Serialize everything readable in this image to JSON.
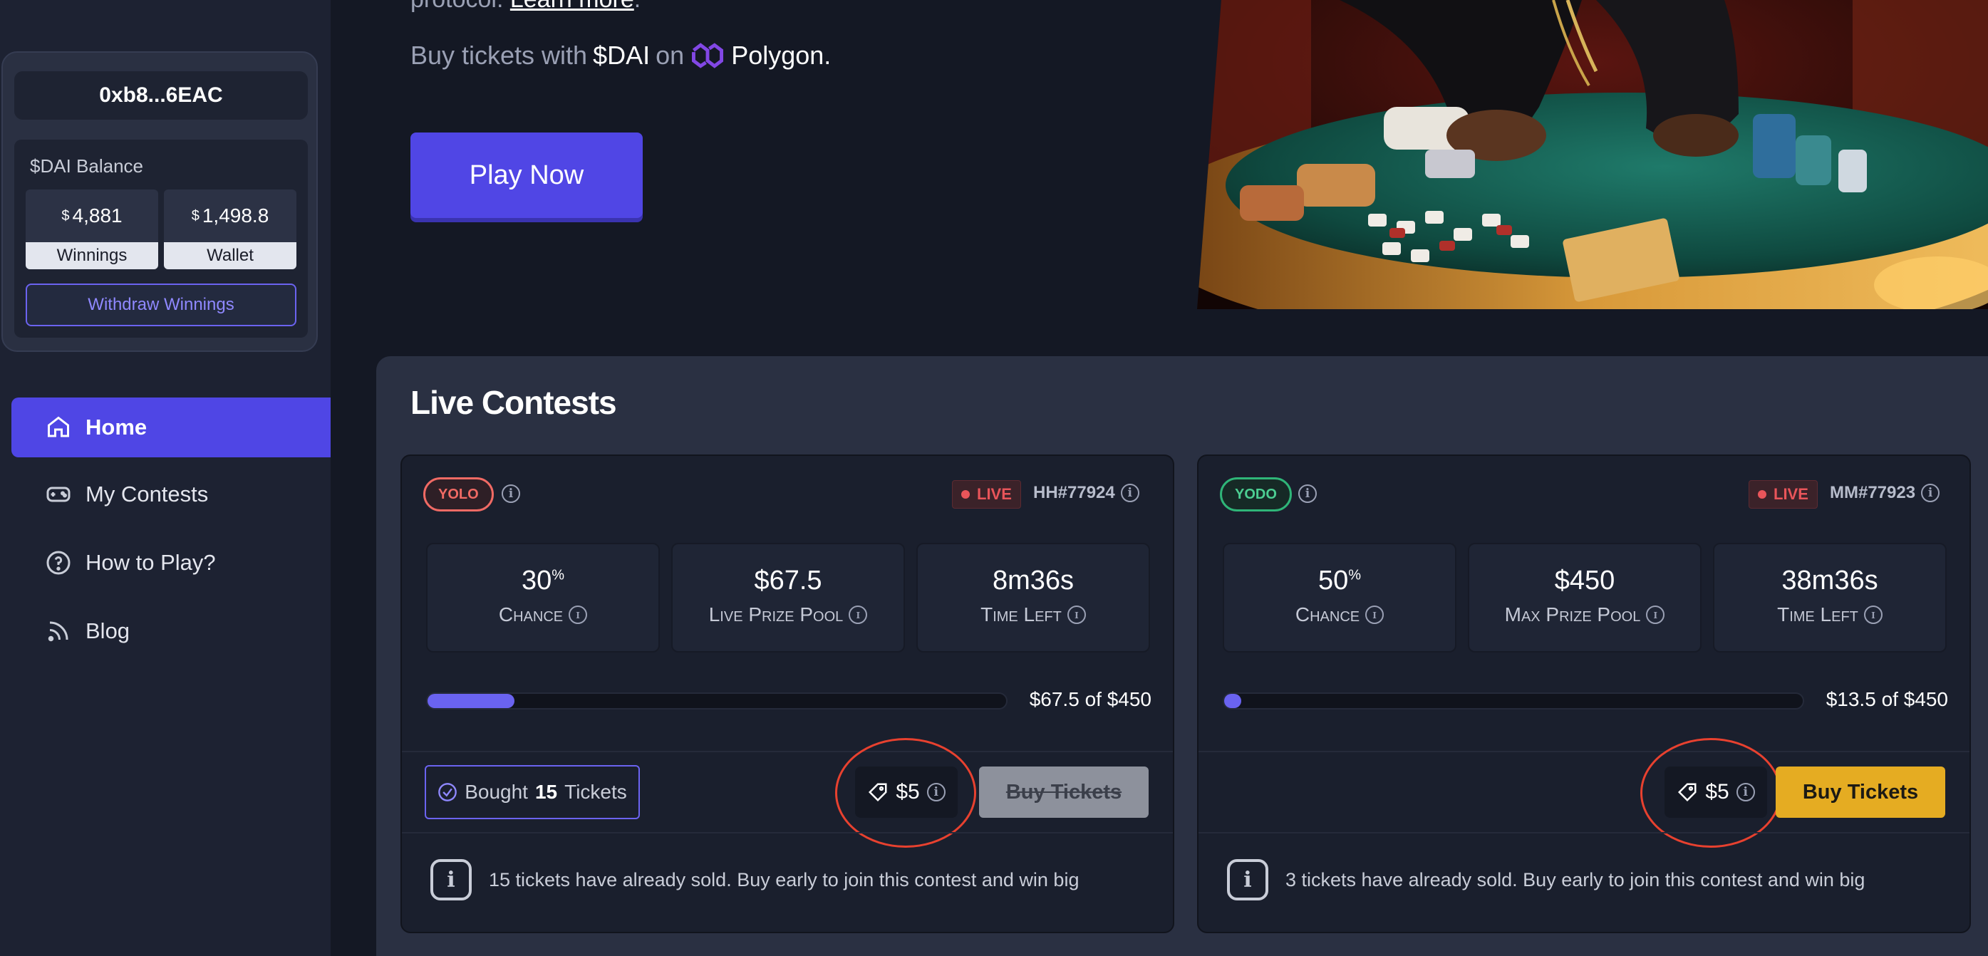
{
  "wallet": {
    "address": "0xb8...6EAC",
    "balance_title": "$DAI Balance",
    "winnings": {
      "currency": "$",
      "amount": "4,881",
      "label": "Winnings"
    },
    "wallet": {
      "currency": "$",
      "amount": "1,498.8",
      "label": "Wallet"
    },
    "withdraw_label": "Withdraw Winnings"
  },
  "nav": {
    "items": [
      {
        "label": "Home",
        "icon": "home-icon",
        "active": true
      },
      {
        "label": "My Contests",
        "icon": "gamepad-icon"
      },
      {
        "label": "How to Play?",
        "icon": "question-icon"
      },
      {
        "label": "Blog",
        "icon": "rss-icon"
      }
    ]
  },
  "hero": {
    "line1_prefix": "protocol.",
    "line1_link": "Learn more",
    "line1_suffix": ".",
    "line2_prefix": "Buy tickets with",
    "line2_token": "$DAI",
    "line2_mid": "on",
    "line2_chain": "Polygon.",
    "play_label": "Play Now"
  },
  "contests": {
    "title": "Live Contests",
    "cards": [
      {
        "tag": "YOLO",
        "live": "LIVE",
        "id": "HH#77924",
        "stats": [
          {
            "value": "30",
            "unit": "%",
            "caption": "Chance"
          },
          {
            "value": "$67.5",
            "unit": "",
            "caption": "Live Prize Pool"
          },
          {
            "value": "8m36s",
            "unit": "",
            "caption": "Time Left"
          }
        ],
        "progress": 0.15,
        "progress_text": "$67.5 of $450",
        "bought_prefix": "Bought",
        "bought_count": "15",
        "bought_suffix": "Tickets",
        "price": "$5",
        "buy_label": "Buy Tickets",
        "note": "15 tickets have already sold. Buy early to join this contest and win big"
      },
      {
        "tag": "YODO",
        "live": "LIVE",
        "id": "MM#77923",
        "stats": [
          {
            "value": "50",
            "unit": "%",
            "caption": "Chance"
          },
          {
            "value": "$450",
            "unit": "",
            "caption": "Max Prize Pool"
          },
          {
            "value": "38m36s",
            "unit": "",
            "caption": "Time Left"
          }
        ],
        "progress": 0.03,
        "progress_text": "$13.5 of $450",
        "price": "$5",
        "buy_label": "Buy Tickets",
        "note": "3 tickets have already sold. Buy early to join this contest and win big"
      }
    ]
  },
  "colors": {
    "accent": "#4f46e5",
    "live_red": "#e9555a",
    "yolo": "#f06a64",
    "yodo": "#2fb578",
    "buy_yellow": "#e5ac22"
  }
}
